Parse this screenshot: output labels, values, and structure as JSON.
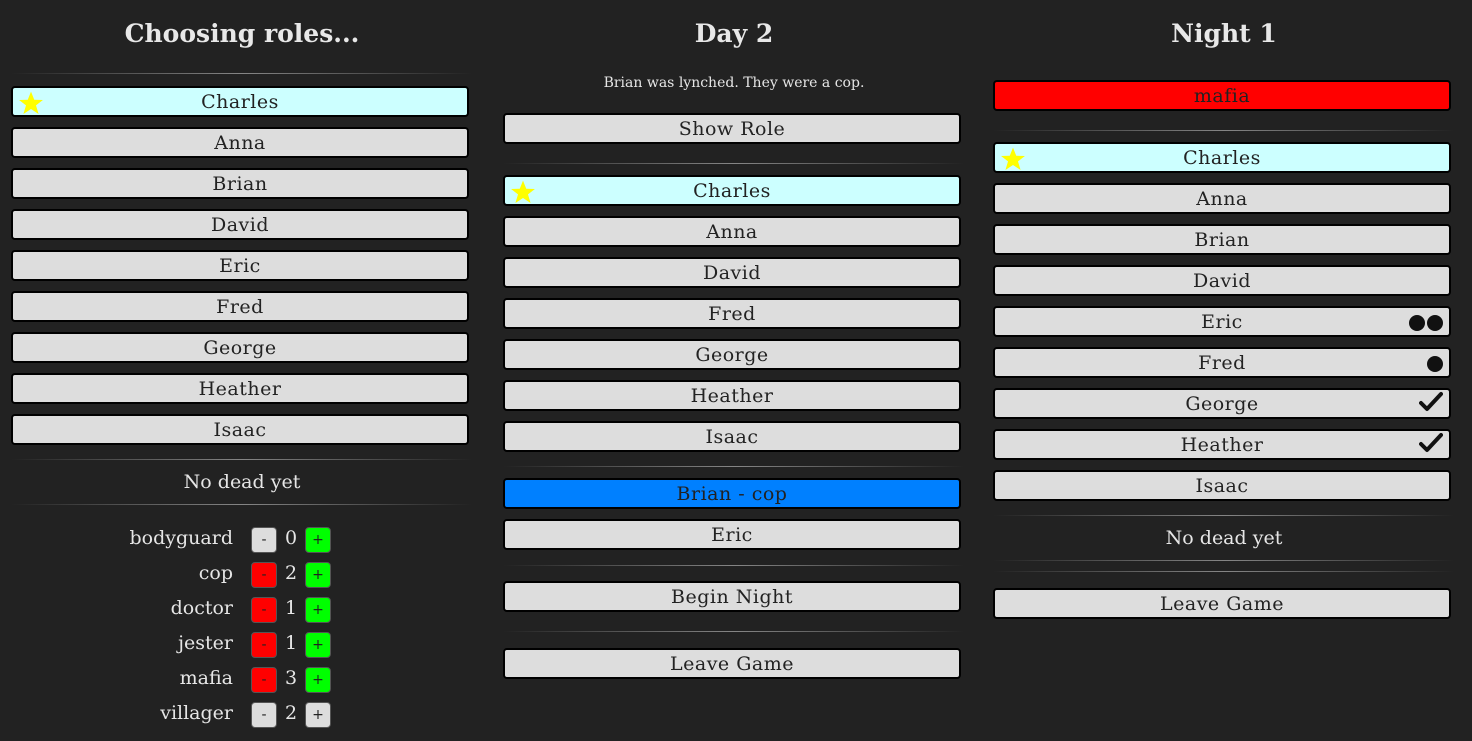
{
  "roles_panel": {
    "title": "Choosing roles...",
    "players": [
      "Charles",
      "Anna",
      "Brian",
      "David",
      "Eric",
      "Fred",
      "George",
      "Heather",
      "Isaac"
    ],
    "dead_status": "No dead yet",
    "roles": [
      {
        "name": "bodyguard",
        "count": "0",
        "minus": "-",
        "plus": "+"
      },
      {
        "name": "cop",
        "count": "2",
        "minus": "-",
        "plus": "+"
      },
      {
        "name": "doctor",
        "count": "1",
        "minus": "-",
        "plus": "+"
      },
      {
        "name": "jester",
        "count": "1",
        "minus": "-",
        "plus": "+"
      },
      {
        "name": "mafia",
        "count": "3",
        "minus": "-",
        "plus": "+"
      },
      {
        "name": "villager",
        "count": "2",
        "minus": "-",
        "plus": "+"
      }
    ]
  },
  "day_panel": {
    "title": "Day 2",
    "announcement": "Brian was lynched. They were a cop.",
    "show_role": "Show Role",
    "players": [
      "Charles",
      "Anna",
      "David",
      "Fred",
      "George",
      "Heather",
      "Isaac"
    ],
    "dead": [
      "Brian - cop",
      "Eric"
    ],
    "begin_night": "Begin Night",
    "leave_game": "Leave Game"
  },
  "night_panel": {
    "title": "Night 1",
    "role_banner": "mafia",
    "players": [
      "Charles",
      "Anna",
      "Brian",
      "David",
      "Eric",
      "Fred",
      "George",
      "Heather",
      "Isaac"
    ],
    "dead_status": "No dead yet",
    "leave_game": "Leave Game"
  },
  "colors": {
    "background": "#222222",
    "button": "#dddddd",
    "self_highlight": "#ccffff",
    "cop_highlight": "#0080ff",
    "mafia_banner": "#ff0000",
    "plus_active": "#00ff00",
    "minus_active": "#ff0000",
    "star": "#ffff00"
  },
  "icons": {
    "self_marker": "star-icon",
    "vote_marker": "dot-icon",
    "confirm_marker": "check-icon"
  }
}
